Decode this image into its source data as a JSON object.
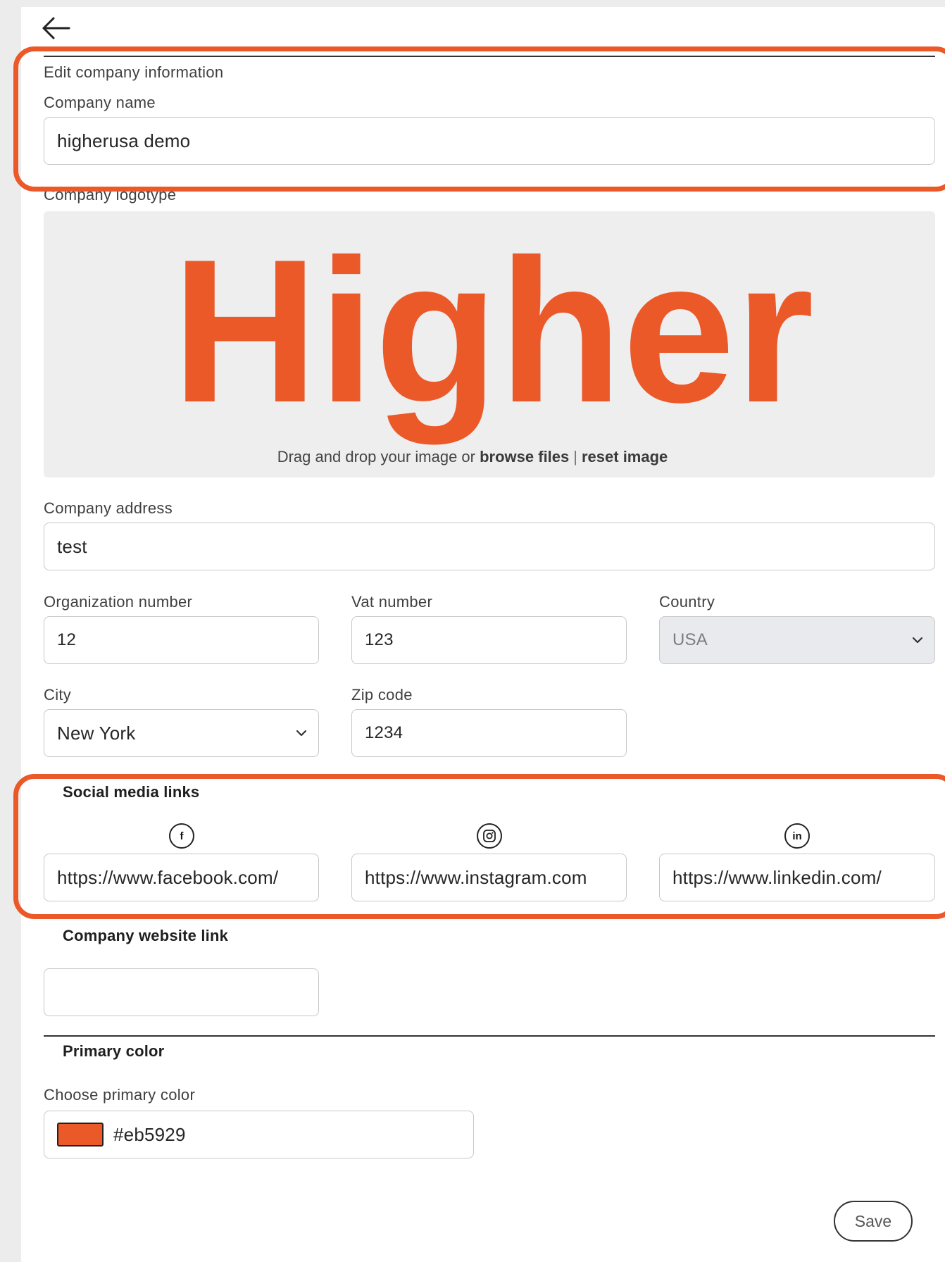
{
  "header": {
    "back_icon": "arrow-left-icon",
    "section_title": "Edit company information"
  },
  "company_name": {
    "label": "Company name",
    "value": "higherusa demo"
  },
  "logo": {
    "label": "Company logotype",
    "logo_text": "Higher",
    "brand_color": "#eb5929",
    "drop_text": "Drag and drop your image or",
    "browse_label": "browse files",
    "separator": "|",
    "reset_label": "reset image"
  },
  "address": {
    "label": "Company address",
    "value": "test"
  },
  "organization_number": {
    "label": "Organization number",
    "value": "12"
  },
  "vat_number": {
    "label": "Vat number",
    "value": "123"
  },
  "country": {
    "label": "Country",
    "value": "USA",
    "disabled": true
  },
  "city": {
    "label": "City",
    "value": "New York"
  },
  "zip_code": {
    "label": "Zip code",
    "value": "1234"
  },
  "social": {
    "title": "Social media links",
    "facebook": {
      "icon": "facebook-icon",
      "glyph": "f",
      "value": "https://www.facebook.com/"
    },
    "instagram": {
      "icon": "instagram-icon",
      "value": "https://www.instagram.com"
    },
    "linkedin": {
      "icon": "linkedin-icon",
      "glyph": "in",
      "value": "https://www.linkedin.com/"
    }
  },
  "website": {
    "title": "Company website link",
    "value": ""
  },
  "primary_color": {
    "title": "Primary color",
    "label": "Choose primary color",
    "value": "#eb5929",
    "swatch_color": "#eb5929"
  },
  "actions": {
    "save_label": "Save"
  },
  "highlight_color": "#eb5929"
}
